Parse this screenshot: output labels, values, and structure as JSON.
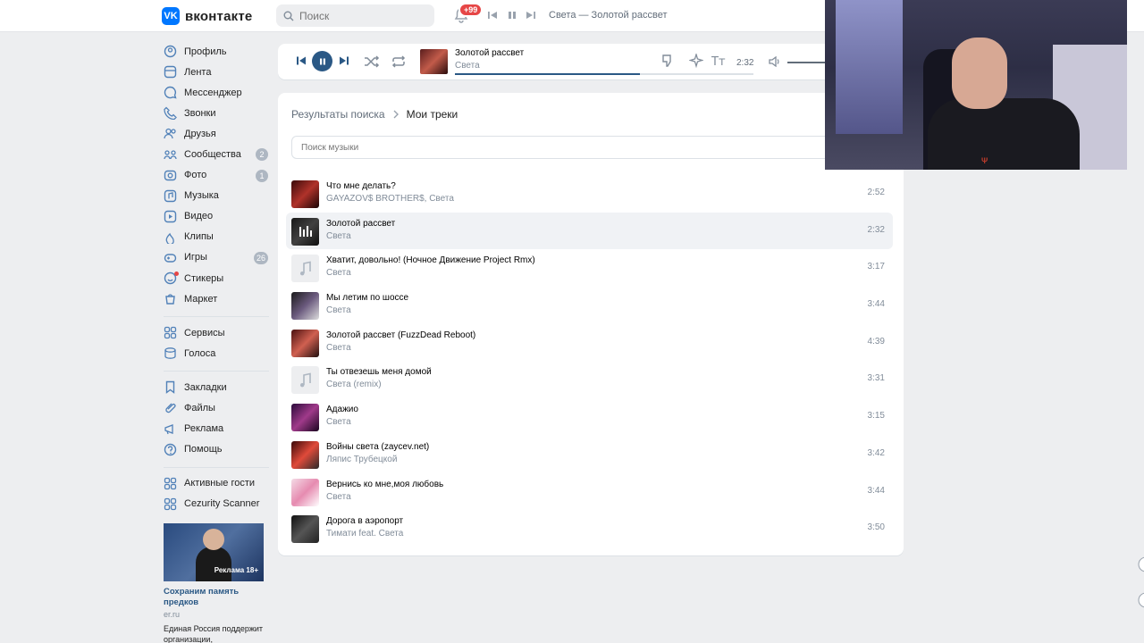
{
  "header": {
    "logo_text": "вконтакте",
    "search_placeholder": "Поиск",
    "notifications_badge": "+99",
    "now_playing": "Света — Золотой рассвет"
  },
  "sidebar": {
    "items": [
      {
        "label": "Профиль",
        "icon": "profile-icon"
      },
      {
        "label": "Лента",
        "icon": "feed-icon"
      },
      {
        "label": "Мессенджер",
        "icon": "messenger-icon"
      },
      {
        "label": "Звонки",
        "icon": "phone-icon"
      },
      {
        "label": "Друзья",
        "icon": "friends-icon"
      },
      {
        "label": "Сообщества",
        "icon": "communities-icon",
        "count": "2"
      },
      {
        "label": "Фото",
        "icon": "photo-icon",
        "count": "1"
      },
      {
        "label": "Музыка",
        "icon": "music-icon"
      },
      {
        "label": "Видео",
        "icon": "video-icon"
      },
      {
        "label": "Клипы",
        "icon": "clips-icon"
      },
      {
        "label": "Игры",
        "icon": "games-icon",
        "count": "26"
      },
      {
        "label": "Стикеры",
        "icon": "stickers-icon"
      },
      {
        "label": "Маркет",
        "icon": "market-icon"
      }
    ],
    "items2": [
      {
        "label": "Сервисы",
        "icon": "services-icon"
      },
      {
        "label": "Голоса",
        "icon": "votes-icon"
      }
    ],
    "items3": [
      {
        "label": "Закладки",
        "icon": "bookmarks-icon"
      },
      {
        "label": "Файлы",
        "icon": "files-icon"
      },
      {
        "label": "Реклама",
        "icon": "ads-icon"
      },
      {
        "label": "Помощь",
        "icon": "help-icon"
      }
    ],
    "items4": [
      {
        "label": "Активные гости",
        "icon": "apps-icon"
      },
      {
        "label": "Cezurity Scanner",
        "icon": "apps-icon"
      }
    ]
  },
  "ad": {
    "badge": "Реклама 18+",
    "title": "Сохраним память предков",
    "domain": "er.ru",
    "text": "Единая Россия поддержит организации,"
  },
  "player": {
    "title": "Золотой рассвет",
    "artist": "Света",
    "time": "2:32",
    "progress": 0.62
  },
  "breadcrumb": {
    "parent": "Результаты поиска",
    "current": "Мои треки"
  },
  "music_search": {
    "placeholder": "Поиск музыки"
  },
  "tracks": [
    {
      "title": "Что мне делать?",
      "artist": "GAYAZOV$ BROTHER$, Света",
      "duration": "2:52"
    },
    {
      "title": "Золотой рассвет",
      "artist": "Света",
      "duration": "2:32"
    },
    {
      "title": "Хватит, довольно! (Ночное Движение Project Rmx)",
      "artist": "Света",
      "duration": "3:17"
    },
    {
      "title": "Мы летим по шоссе",
      "artist": "Света",
      "duration": "3:44"
    },
    {
      "title": "Золотой рассвет (FuzzDead Reboot)",
      "artist": "Света",
      "duration": "4:39"
    },
    {
      "title": "Ты отвезешь меня домой",
      "artist": "Света (remix)",
      "duration": "3:31"
    },
    {
      "title": "Адажио",
      "artist": "Света",
      "duration": "3:15"
    },
    {
      "title": "Войны света (zaycev.net)",
      "artist": "Ляпис Трубецкой",
      "duration": "3:42"
    },
    {
      "title": "Вернись ко мне,моя любовь",
      "artist": "Света",
      "duration": "3:44"
    },
    {
      "title": "Дорога в аэропорт",
      "artist": "Тимати feat. Света",
      "duration": "3:50"
    }
  ],
  "colors": {
    "accent": "#2a5885",
    "brand": "#0077ff",
    "badge": "#e64646"
  }
}
